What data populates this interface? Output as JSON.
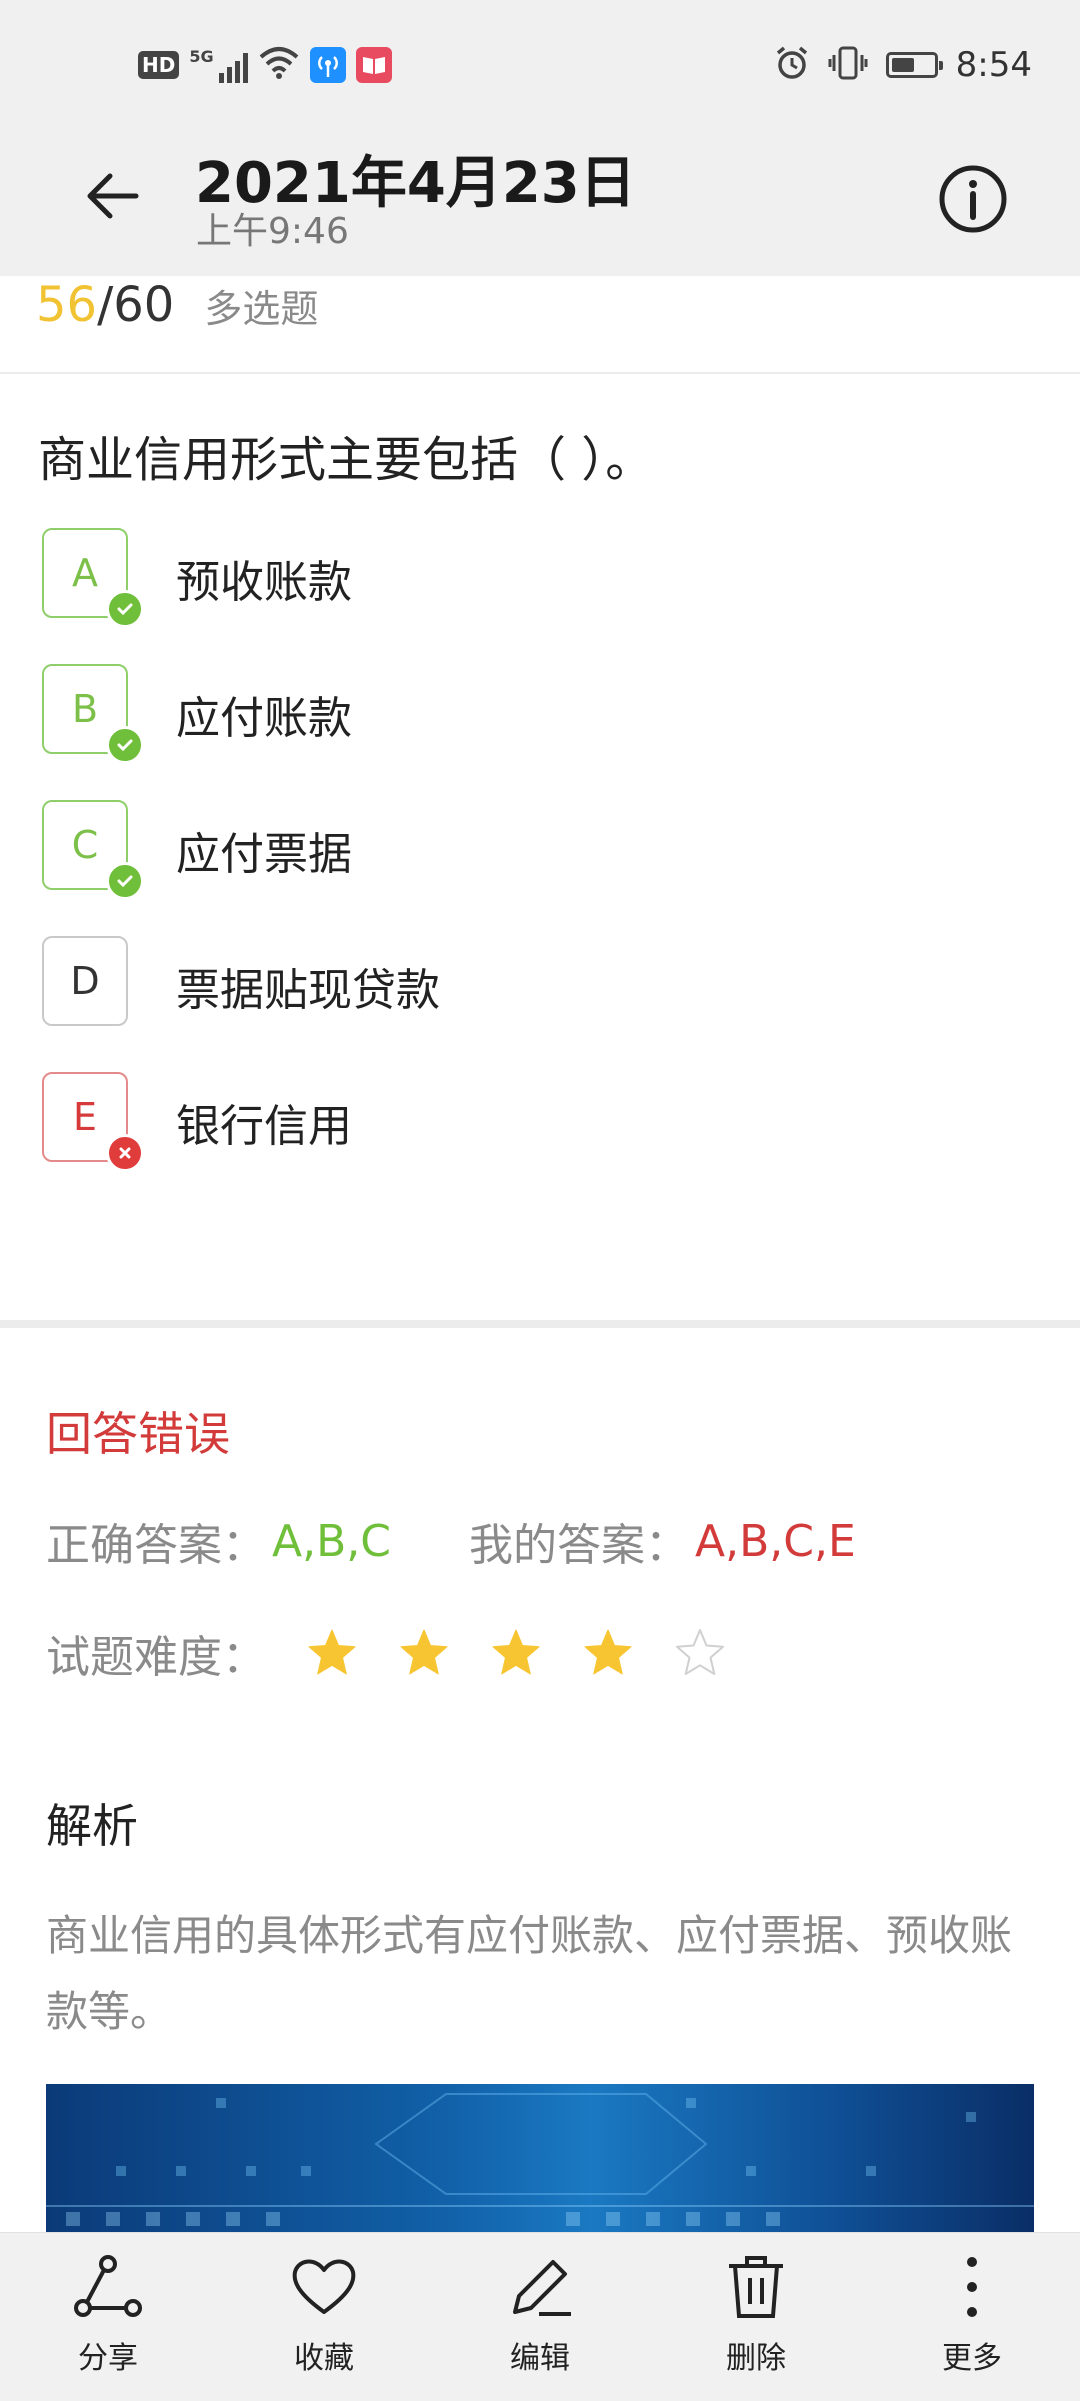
{
  "status_bar": {
    "network_badge": "HD",
    "network_type": "5G",
    "time": "8:54",
    "battery_level": 0.55,
    "icons": [
      "hd-icon",
      "signal-5g-icon",
      "wifi-icon",
      "hotspot-icon",
      "book-app-icon",
      "alarm-icon",
      "vibrate-icon",
      "battery-icon"
    ]
  },
  "header": {
    "title": "2021年4月23日",
    "subtitle": "上午9:46",
    "back_icon": "back-arrow-icon",
    "info_icon": "info-icon"
  },
  "progress": {
    "current": "56",
    "separator": "/",
    "total": "60",
    "question_type": "多选题"
  },
  "question": {
    "text": "商业信用形式主要包括（ ）。",
    "options": [
      {
        "letter": "A",
        "text": "预收账款",
        "state": "correct"
      },
      {
        "letter": "B",
        "text": "应付账款",
        "state": "correct"
      },
      {
        "letter": "C",
        "text": "应付票据",
        "state": "correct"
      },
      {
        "letter": "D",
        "text": "票据贴现贷款",
        "state": "neutral"
      },
      {
        "letter": "E",
        "text": "银行信用",
        "state": "wrong"
      }
    ]
  },
  "result": {
    "title": "回答错误",
    "correct_label": "正确答案：",
    "correct_value": "A,B,C",
    "my_label": "我的答案：",
    "my_value": "A,B,C,E",
    "difficulty_label": "试题难度：",
    "difficulty_stars": 4,
    "difficulty_max": 5
  },
  "analysis": {
    "title": "解析",
    "text": "商业信用的具体形式有应付账款、应付票据、预收账款等。"
  },
  "bottom_bar": {
    "share": "分享",
    "favorite": "收藏",
    "edit": "编辑",
    "delete": "删除",
    "more": "更多"
  },
  "colors": {
    "correct": "#6fbf3a",
    "wrong": "#d33b3b",
    "progress_current": "#f1c232",
    "star": "#f7c531"
  }
}
